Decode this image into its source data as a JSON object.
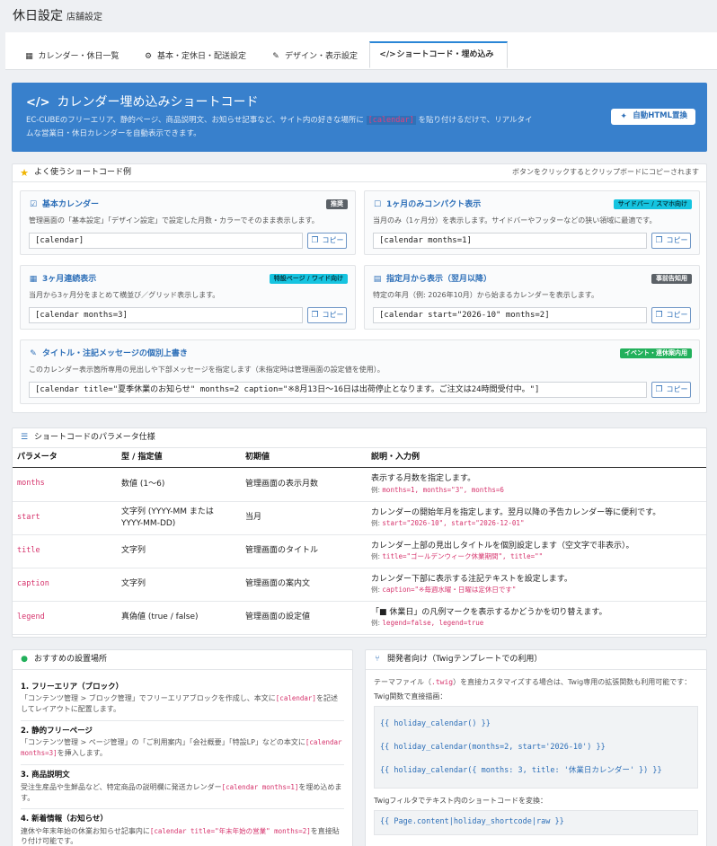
{
  "header": {
    "title": "休日設定",
    "subtitle": "店舗設定"
  },
  "tabs": [
    {
      "label": "カレンダー・休日一覧",
      "icon": "calendar-icon"
    },
    {
      "label": "基本・定休日・配送設定",
      "icon": "gear-icon"
    },
    {
      "label": "デザイン・表示設定",
      "icon": "brush-icon"
    },
    {
      "label": "ショートコード・埋め込み",
      "icon": "code-icon",
      "active": true
    }
  ],
  "hero": {
    "title": "カレンダー埋め込みショートコード",
    "desc_before": "EC-CUBEのフリーエリア、静的ページ、商品説明文、お知らせ記事など、サイト内の好きな場所に",
    "desc_code": "[calendar]",
    "desc_after": "を貼り付けるだけで、リアルタイムな営業日・休日カレンダーを自動表示できます。",
    "auto_button": "自動HTML置換"
  },
  "examples": {
    "title": "よく使うショートコード例",
    "hint": "ボタンをクリックするとクリップボードにコピーされます",
    "copy_label": "コピー",
    "cards": [
      {
        "title": "基本カレンダー",
        "badge": "推奨",
        "desc": "管理画面の「基本設定」「デザイン設定」で設定した月数・カラーでそのまま表示します。",
        "code": "[calendar]"
      },
      {
        "title": "1ヶ月のみコンパクト表示",
        "badge": "サイドバー / スマホ向け",
        "desc": "当月のみ（1ヶ月分）を表示します。サイドバーやフッターなどの狭い領域に最適です。",
        "code": "[calendar months=1]"
      },
      {
        "title": "3ヶ月連続表示",
        "badge": "特設ページ / ワイド向け",
        "desc": "当月から3ヶ月分をまとめて横並び／グリッド表示します。",
        "code": "[calendar months=3]"
      },
      {
        "title": "指定月から表示（翌月以降）",
        "badge": "事前告知用",
        "desc": "特定の年月（例: 2026年10月）から始まるカレンダーを表示します。",
        "code": "[calendar start=\"2026-10\" months=2]"
      },
      {
        "title": "タイトル・注記メッセージの個別上書き",
        "badge": "イベント・連休案内用",
        "desc": "このカレンダー表示箇所専用の見出しや下部メッセージを指定します（未指定時は管理画面の設定値を使用）。",
        "code": "[calendar title=\"夏季休業のお知らせ\" months=2 caption=\"※8月13日〜16日は出荷停止となります。ご注文は24時間受付中。\"]"
      }
    ]
  },
  "params": {
    "title": "ショートコードのパラメータ仕様",
    "headers": [
      "パラメータ",
      "型 / 指定値",
      "初期値",
      "説明・入力例"
    ],
    "example_prefix": "例: ",
    "rows": [
      {
        "name": "months",
        "type": "数値 (1〜6)",
        "default": "管理画面の表示月数",
        "desc": "表示する月数を指定します。",
        "example": "months=1, months=\"3\", months=6"
      },
      {
        "name": "start",
        "type": "文字列 (YYYY-MM または YYYY-MM-DD)",
        "default": "当月",
        "desc": "カレンダーの開始年月を指定します。翌月以降の予告カレンダー等に便利です。",
        "example": "start=\"2026-10\", start=\"2026-12-01\""
      },
      {
        "name": "title",
        "type": "文字列",
        "default": "管理画面のタイトル",
        "desc": "カレンダー上部の見出しタイトルを個別設定します（空文字で非表示）。",
        "example": "title=\"ゴールデンウィーク休業期間\", title=\"\""
      },
      {
        "name": "caption",
        "type": "文字列",
        "default": "管理画面の案内文",
        "desc": "カレンダー下部に表示する注記テキストを設定します。",
        "example": "caption=\"※毎週水曜・日曜は定休日です\""
      },
      {
        "name": "legend",
        "type": "真偽値 (true / false)",
        "default": "管理画面の設定値",
        "desc": "「■ 休業日」の凡例マークを表示するかどうかを切り替えます。",
        "example": "legend=false, legend=true"
      }
    ]
  },
  "placement": {
    "title": "おすすめの設置場所",
    "items": [
      {
        "h": "1. フリーエリア（ブロック）",
        "d1": "「コンテンツ管理 > ブロック管理」でフリーエリアブロックを作成し、本文に",
        "code": "[calendar]",
        "d2": "を記述してレイアウトに配置します。"
      },
      {
        "h": "2. 静的フリーページ",
        "d1": "「コンテンツ管理 > ページ管理」の「ご利用案内」「会社概要」「特設LP」などの本文に",
        "code": "[calendar months=3]",
        "d2": "を挿入します。"
      },
      {
        "h": "3. 商品説明文",
        "d1": "受注生産品や生鮮品など、特定商品の説明欄に発送カレンダー",
        "code": "[calendar months=1]",
        "d2": "を埋め込めます。"
      },
      {
        "h": "4. 新着情報（お知らせ）",
        "d1": "連休や年末年始の休業お知らせ記事内に",
        "code": "[calendar title=\"年末年始の営業\" months=2]",
        "d2": "を直接貼り付け可能です。"
      }
    ]
  },
  "developer": {
    "title": "開発者向け（Twigテンプレートでの利用）",
    "intro_before": "テーマファイル（",
    "intro_code": ".twig",
    "intro_after": "）を直接カスタマイズする場合は、Twig専用の拡張関数も利用可能です：",
    "func_label": "Twig関数で直接描画：",
    "func_lines": [
      "{{ holiday_calendar() }}",
      "{{ holiday_calendar(months=2, start='2026-10') }}",
      "{{ holiday_calendar({ months: 3, title: '休業日カレンダー' }) }}"
    ],
    "filter_label": "Twigフィルタでテキスト内のショートコードを変換：",
    "filter_line": "{{ Page.content|holiday_shortcode|raw }}"
  }
}
